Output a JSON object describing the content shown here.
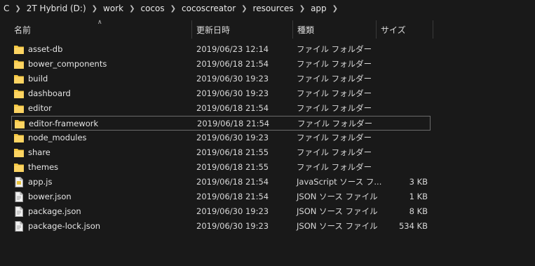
{
  "breadcrumb": [
    "C",
    "2T Hybrid (D:)",
    "work",
    "cocos",
    "cocoscreator",
    "resources",
    "app"
  ],
  "columns": {
    "name": "名前",
    "date": "更新日時",
    "type": "種類",
    "size": "サイズ"
  },
  "files": [
    {
      "name": "asset-db",
      "date": "2019/06/23 12:14",
      "type": "ファイル フォルダー",
      "size": "",
      "icon": "folder-icon"
    },
    {
      "name": "bower_components",
      "date": "2019/06/18 21:54",
      "type": "ファイル フォルダー",
      "size": "",
      "icon": "folder-icon"
    },
    {
      "name": "build",
      "date": "2019/06/30 19:23",
      "type": "ファイル フォルダー",
      "size": "",
      "icon": "folder-icon"
    },
    {
      "name": "dashboard",
      "date": "2019/06/30 19:23",
      "type": "ファイル フォルダー",
      "size": "",
      "icon": "folder-icon"
    },
    {
      "name": "editor",
      "date": "2019/06/18 21:54",
      "type": "ファイル フォルダー",
      "size": "",
      "icon": "folder-icon"
    },
    {
      "name": "editor-framework",
      "date": "2019/06/18 21:54",
      "type": "ファイル フォルダー",
      "size": "",
      "icon": "folder-icon"
    },
    {
      "name": "node_modules",
      "date": "2019/06/30 19:23",
      "type": "ファイル フォルダー",
      "size": "",
      "icon": "folder-icon"
    },
    {
      "name": "share",
      "date": "2019/06/18 21:55",
      "type": "ファイル フォルダー",
      "size": "",
      "icon": "folder-icon"
    },
    {
      "name": "themes",
      "date": "2019/06/18 21:55",
      "type": "ファイル フォルダー",
      "size": "",
      "icon": "folder-icon"
    },
    {
      "name": "app.js",
      "date": "2019/06/18 21:54",
      "type": "JavaScript ソース フ...",
      "size": "3 KB",
      "icon": "js-file-icon"
    },
    {
      "name": "bower.json",
      "date": "2019/06/18 21:54",
      "type": "JSON ソース ファイル",
      "size": "1 KB",
      "icon": "file-icon"
    },
    {
      "name": "package.json",
      "date": "2019/06/30 19:23",
      "type": "JSON ソース ファイル",
      "size": "8 KB",
      "icon": "file-icon"
    },
    {
      "name": "package-lock.json",
      "date": "2019/06/30 19:23",
      "type": "JSON ソース ファイル",
      "size": "534 KB",
      "icon": "file-icon"
    }
  ],
  "focused_index": 5,
  "colors": {
    "background": "#191919",
    "folder": "#f5c842",
    "text": "#e4e4e4"
  }
}
